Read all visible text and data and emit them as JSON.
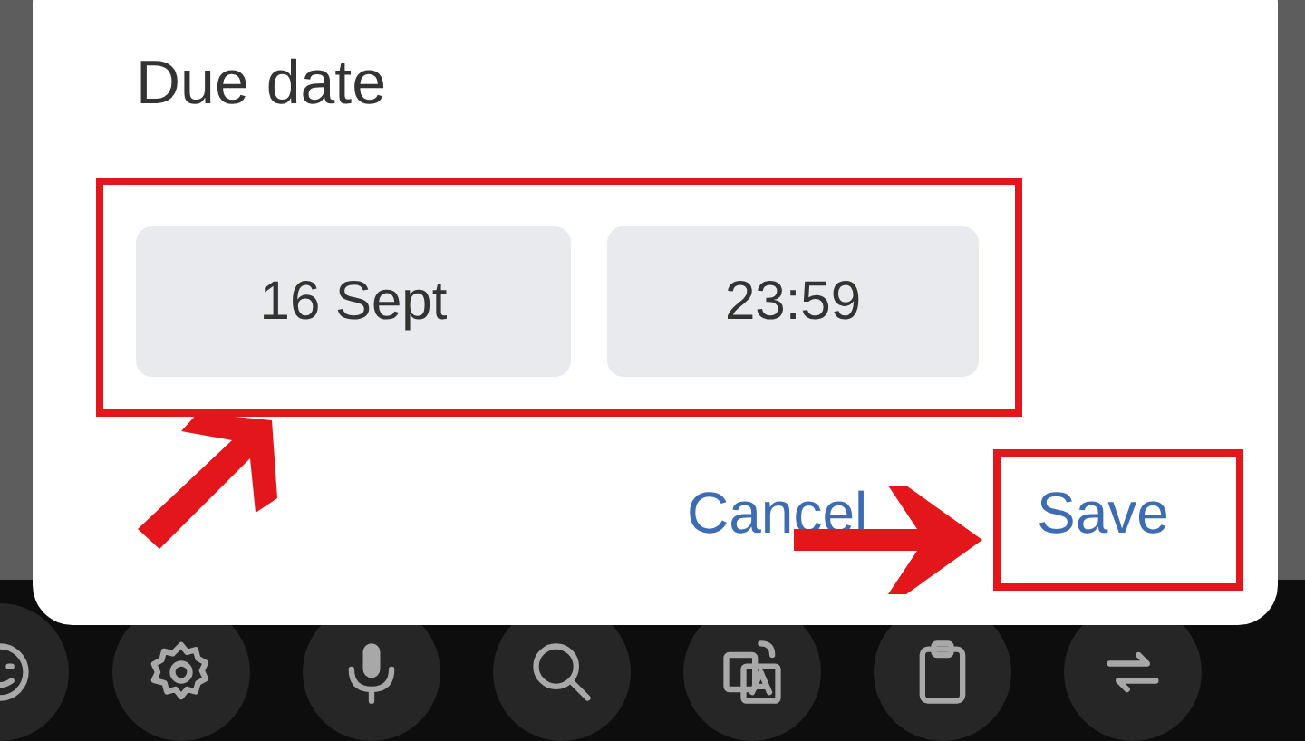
{
  "dialog": {
    "title": "Due date",
    "date": "16 Sept",
    "time": "23:59",
    "actions": [
      {
        "label": "Cancel"
      },
      {
        "label": "Save"
      }
    ]
  },
  "keyboard_toolbar": [
    {
      "kind": "emoji"
    },
    {
      "kind": "settings"
    },
    {
      "kind": "mic"
    },
    {
      "kind": "search"
    },
    {
      "kind": "translate"
    },
    {
      "kind": "clipboard"
    },
    {
      "kind": "switch"
    }
  ]
}
